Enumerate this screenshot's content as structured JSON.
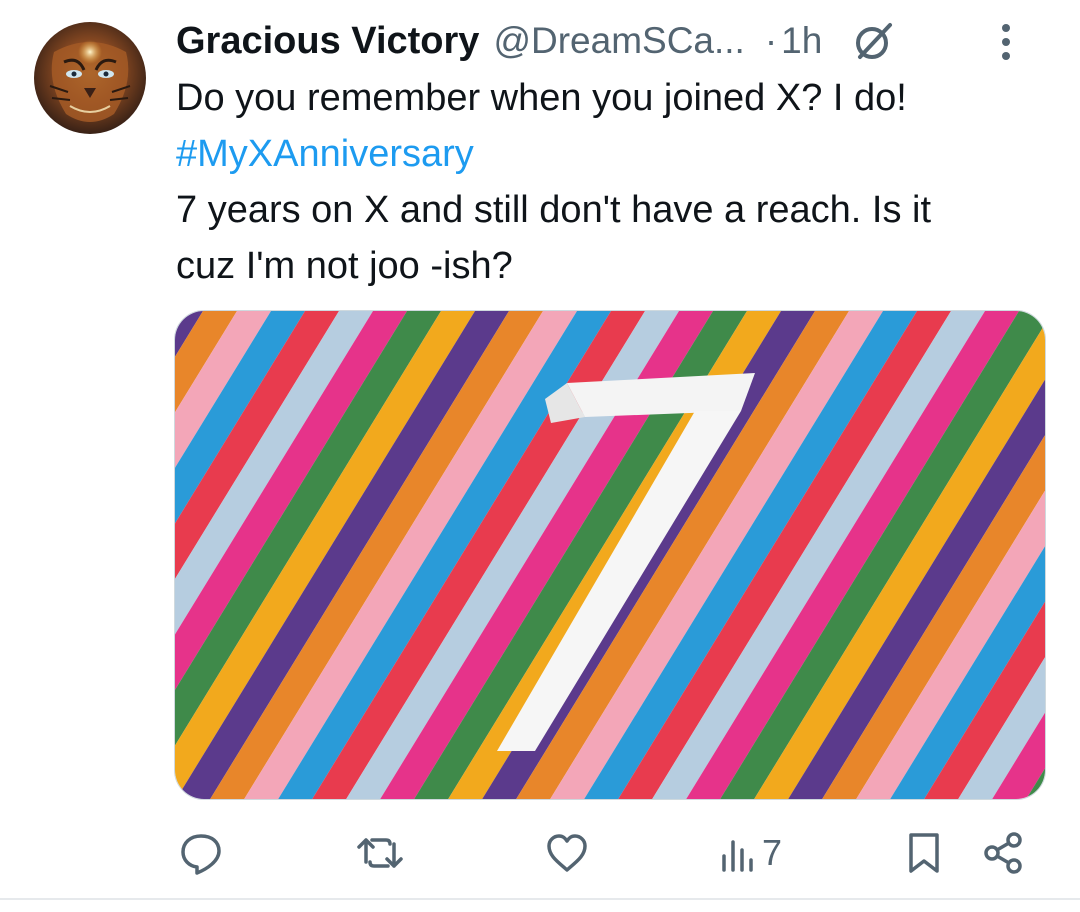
{
  "tweet": {
    "author": {
      "display_name": "Gracious Victory",
      "handle": "@DreamSCa...",
      "avatar_icon": "tiger-avatar"
    },
    "separator": "·",
    "time": "1h",
    "header_icons": [
      "grok-icon",
      "more-vertical-icon"
    ],
    "text": {
      "line1": "Do you remember when you joined X? I do!",
      "hashtag": "#MyXAnniversary",
      "line3": "7 years on X and still don't have a reach. Is it",
      "line4": "cuz I'm not joo -ish?"
    },
    "media": {
      "description_icon": "anniversary-7-image",
      "numeral": "7"
    },
    "actions": {
      "reply": {
        "icon": "reply-icon"
      },
      "repost": {
        "icon": "repost-icon"
      },
      "like": {
        "icon": "like-icon"
      },
      "views": {
        "icon": "views-icon",
        "count": "7"
      },
      "bookmark": {
        "icon": "bookmark-icon"
      },
      "share": {
        "icon": "share-icon"
      }
    }
  },
  "colors": {
    "text": "#0f1419",
    "secondary": "#536471",
    "link": "#1d9bf0",
    "stripes": [
      "#f2a91d",
      "#5b3a8c",
      "#e8862a",
      "#f3a6b8",
      "#2a9bd8",
      "#e83b4e",
      "#b6cde0",
      "#e6338a",
      "#3f8a4a"
    ]
  }
}
